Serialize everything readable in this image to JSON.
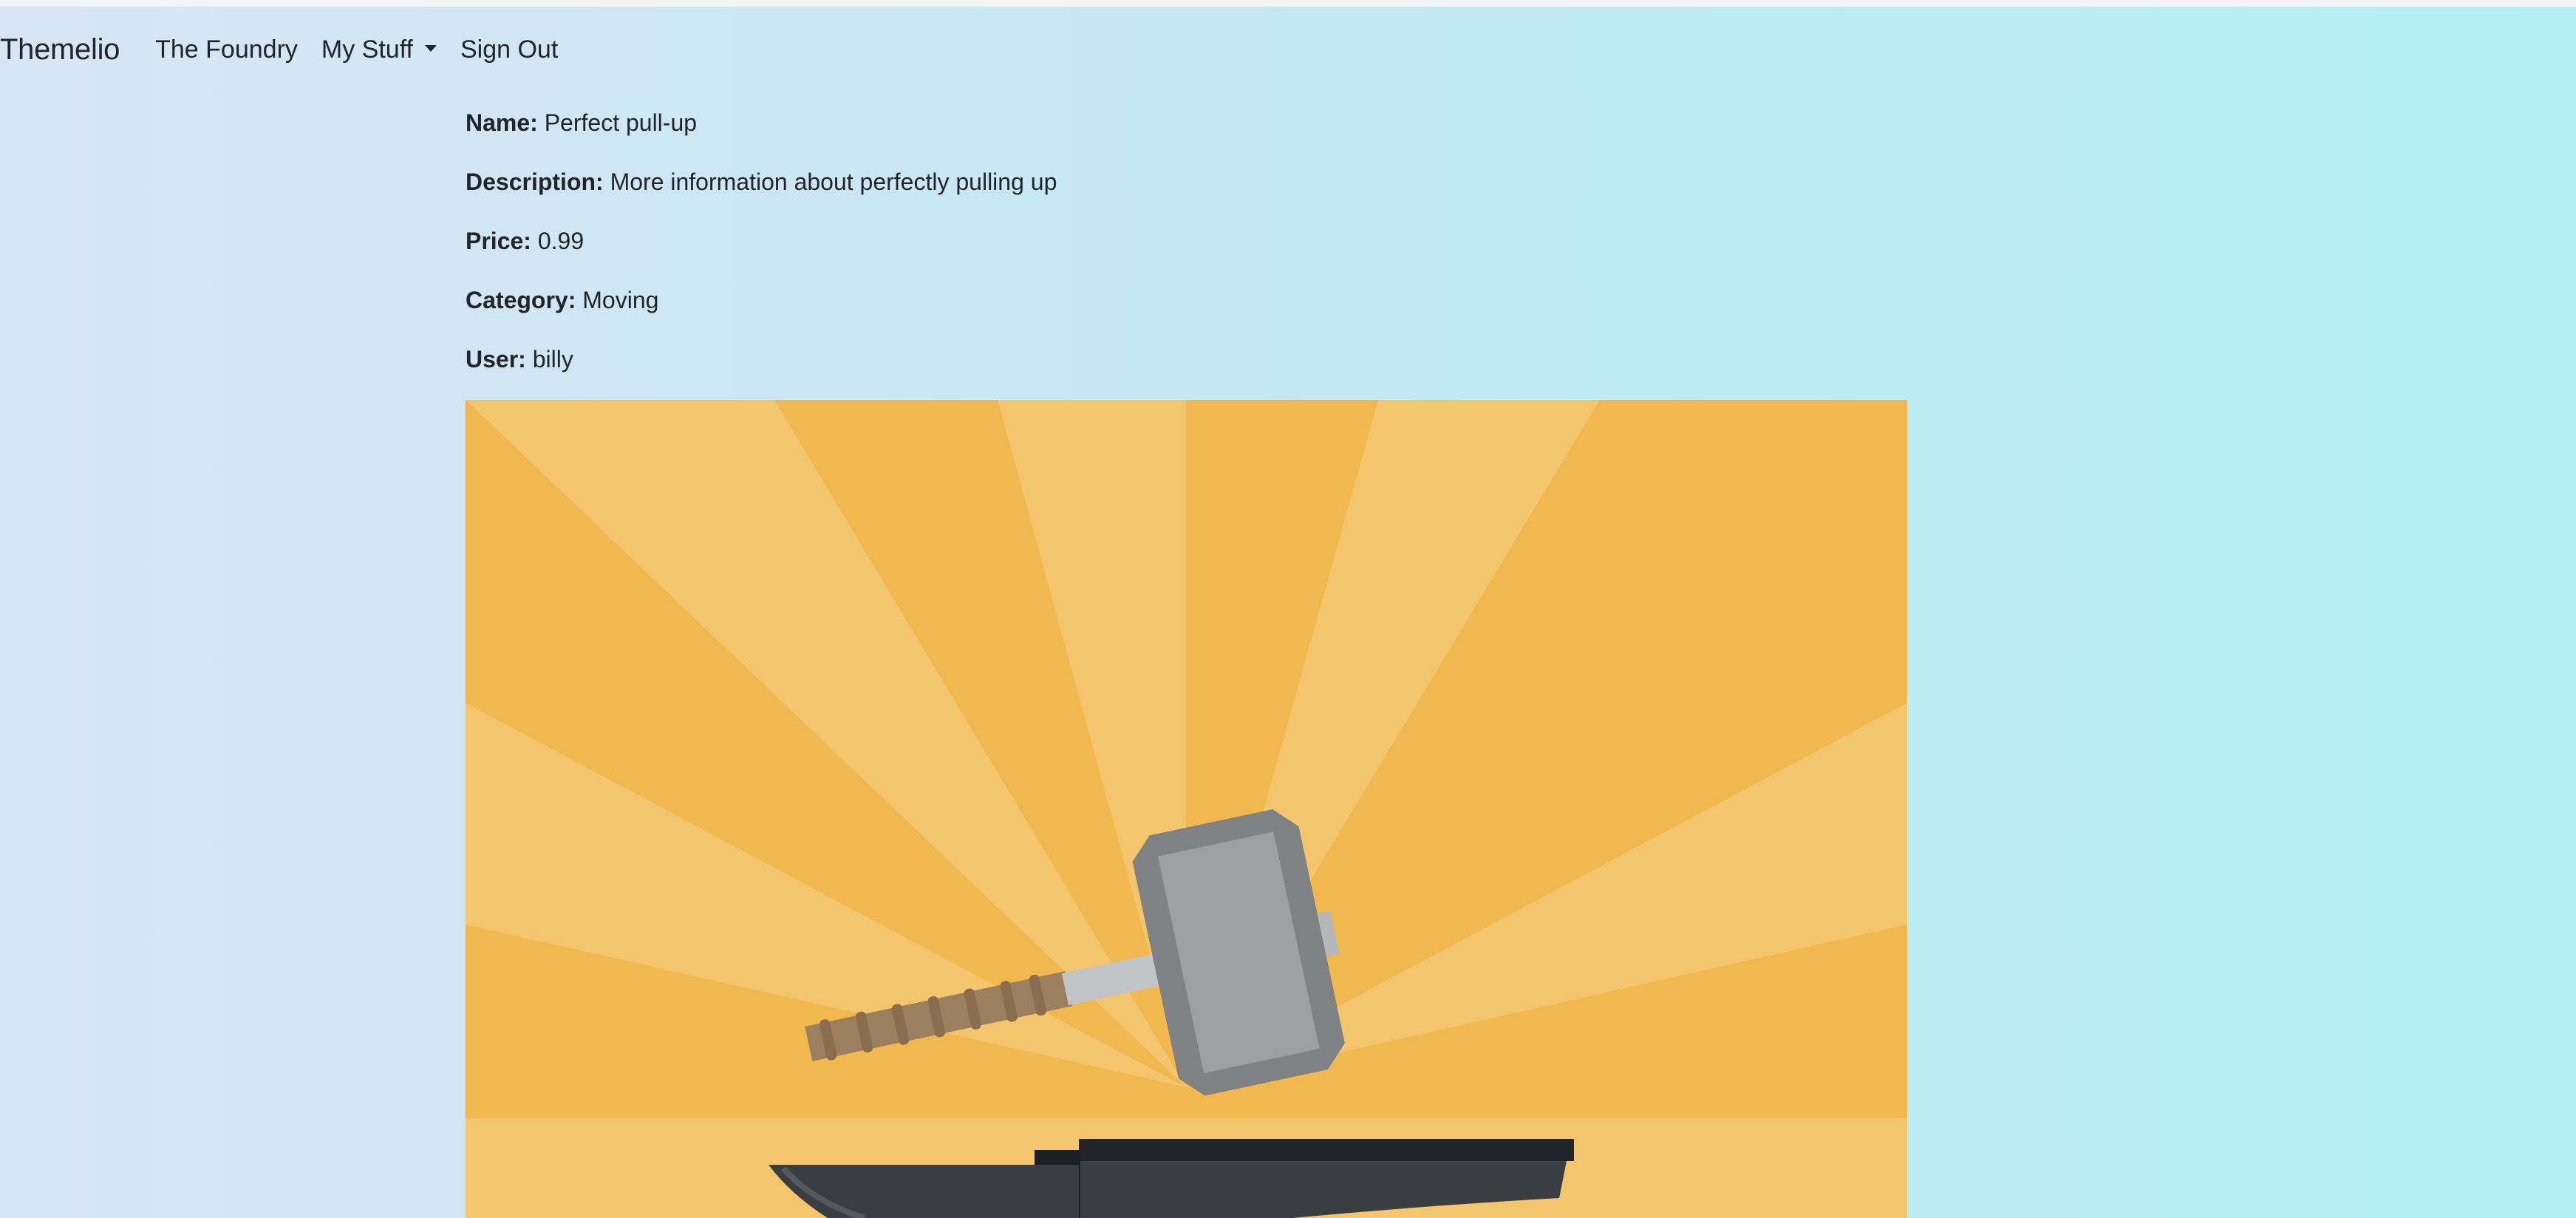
{
  "navbar": {
    "brand": "Themelio",
    "links": [
      {
        "label": "The Foundry"
      },
      {
        "label": "My Stuff",
        "dropdown": true
      },
      {
        "label": "Sign Out"
      }
    ]
  },
  "item": {
    "name_label": "Name:",
    "name": "Perfect pull-up",
    "description_label": "Description:",
    "description": "More information about perfectly pulling up",
    "price_label": "Price:",
    "price": "0.99",
    "category_label": "Category:",
    "category": "Moving",
    "user_label": "User:",
    "user": "billy"
  },
  "image": {
    "subject": "hammer-and-anvil-illustration",
    "colors": {
      "ray_dark": "#f0b84e",
      "ray_light": "#f3c66e",
      "hammer_head": "#9d9fa1",
      "hammer_shadow": "#7f8183",
      "handle": "#c3c4c6",
      "grip": "#9c7f5e",
      "anvil": "#3a3e42"
    }
  },
  "theme": {
    "gradient_start": "#d8e5f4",
    "gradient_end": "#b4eff5",
    "text": "#212529"
  }
}
